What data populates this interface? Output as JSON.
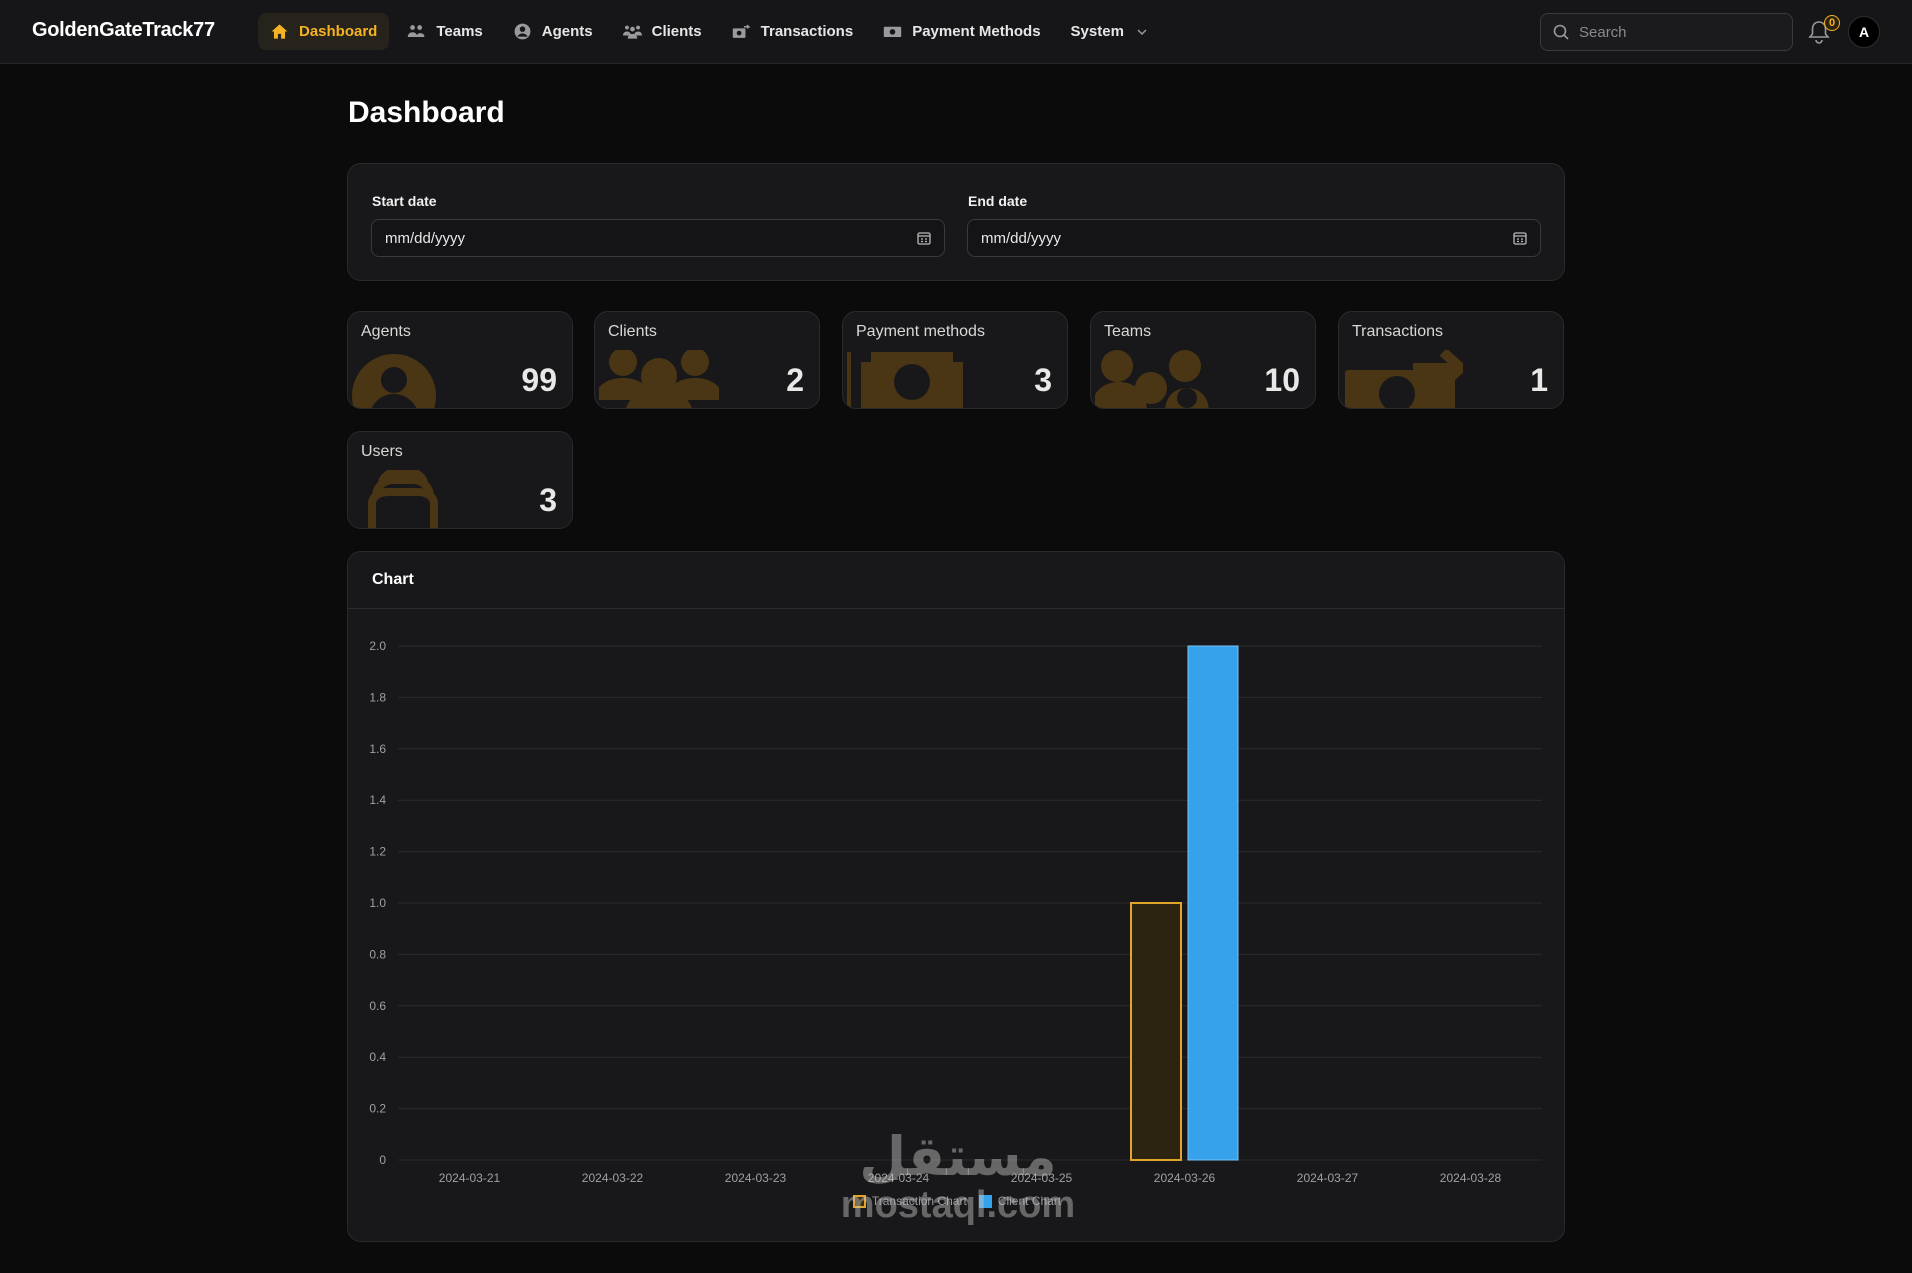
{
  "app": {
    "brand": "GoldenGateTrack77"
  },
  "nav": {
    "items": [
      {
        "label": "Dashboard",
        "icon": "home-icon",
        "active": true
      },
      {
        "label": "Teams",
        "icon": "users-group-icon"
      },
      {
        "label": "Agents",
        "icon": "user-circle-icon"
      },
      {
        "label": "Clients",
        "icon": "users-icon"
      },
      {
        "label": "Transactions",
        "icon": "cash-arrow-icon"
      },
      {
        "label": "Payment Methods",
        "icon": "banknote-icon"
      },
      {
        "label": "System",
        "icon": "chevron-down-icon"
      }
    ],
    "search_placeholder": "Search",
    "notifications_count": "0",
    "avatar_initial": "A"
  },
  "page": {
    "title": "Dashboard"
  },
  "filters": {
    "start_label": "Start date",
    "start_value": "mm/dd/yyyy",
    "end_label": "End date",
    "end_value": "mm/dd/yyyy"
  },
  "stats": [
    {
      "label": "Agents",
      "value": "99",
      "icon": "user-circle-icon"
    },
    {
      "label": "Clients",
      "value": "2",
      "icon": "users-icon"
    },
    {
      "label": "Payment methods",
      "value": "3",
      "icon": "banknote-icon"
    },
    {
      "label": "Teams",
      "value": "10",
      "icon": "users-group-icon"
    },
    {
      "label": "Transactions",
      "value": "1",
      "icon": "cash-arrow-icon"
    },
    {
      "label": "Users",
      "value": "3",
      "icon": "stack-icon"
    }
  ],
  "chart": {
    "title": "Chart"
  },
  "chart_data": {
    "type": "bar",
    "categories": [
      "2024-03-21",
      "2024-03-22",
      "2024-03-23",
      "2024-03-24",
      "2024-03-25",
      "2024-03-26",
      "2024-03-27",
      "2024-03-28"
    ],
    "series": [
      {
        "name": "Transaction Chart",
        "values": [
          0,
          0,
          0,
          0,
          0,
          1,
          0,
          0
        ],
        "color": "#e0a52a"
      },
      {
        "name": "Client Chart",
        "values": [
          0,
          0,
          0,
          0,
          0,
          2,
          0,
          0
        ],
        "color": "#36a2eb"
      }
    ],
    "ylim": [
      0,
      2
    ],
    "yticks": [
      "0",
      "0.2",
      "0.4",
      "0.6",
      "0.8",
      "1.0",
      "1.2",
      "1.4",
      "1.6",
      "1.8",
      "2.0"
    ],
    "grid": true,
    "legend": "bottom"
  },
  "watermark": {
    "arabic": "مستقل",
    "latin": "mostaql.com"
  },
  "colors": {
    "accent": "#f5b324",
    "bg": "#0b0b0c",
    "card": "#18181a",
    "icon_fill": "#4a3614"
  }
}
